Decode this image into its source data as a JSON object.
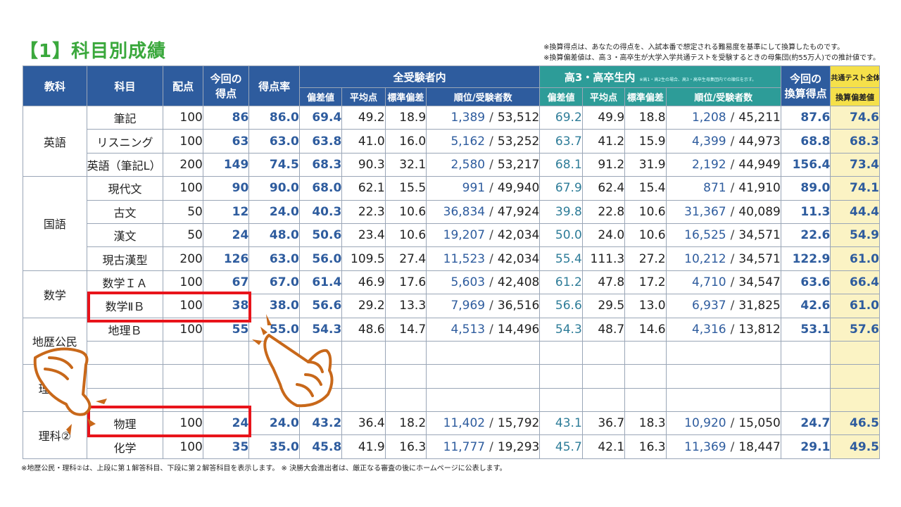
{
  "title": "【1】科目別成績",
  "notes": [
    "※換算得点は、あなたの得点を、入試本番で想定される難易度を基準にして換算したものです。",
    "※換算偏差値は、高３・高卒生が大学入学共通テストを受験するときの母集団(約55万人)での推計値です。"
  ],
  "headers": {
    "kyouka": "教科",
    "kamoku": "科目",
    "haiten": "配点",
    "konkai_line1": "今回の",
    "konkai_line2": "得点",
    "tokutenritsu": "得点率",
    "all_group": "全受験者内",
    "hs_group": "高3・高卒生内",
    "hs_note": "※高1・高2生の場合、高3・高卒生母集団内での順位を示す。",
    "hensachi": "偏差値",
    "heikin": "平均点",
    "hyoujun": "標準偏差",
    "juni": "順位/受験者数",
    "kansan_line1": "今回の",
    "kansan_line2": "換算得点",
    "common_test": "共通テスト全体",
    "kansan_hensachi": "換算偏差値"
  },
  "groups": {
    "english": "英語",
    "japanese": "国語",
    "math": "数学",
    "social": "地歴公民",
    "science1": "理科①",
    "science2": "理科②"
  },
  "rows": [
    {
      "subject": "筆記",
      "haiten": "100",
      "score": "86",
      "rate": "86.0",
      "dev": "69.4",
      "avg": "49.2",
      "sd": "18.9",
      "rank": "1,389",
      "total": "53,512",
      "hs_dev": "69.2",
      "hs_avg": "49.9",
      "hs_sd": "18.8",
      "hs_rank": "1,208",
      "hs_total": "45,211",
      "conv": "87.6",
      "conv_dev": "74.6"
    },
    {
      "subject": "リスニング",
      "haiten": "100",
      "score": "63",
      "rate": "63.0",
      "dev": "63.8",
      "avg": "41.0",
      "sd": "16.0",
      "rank": "5,162",
      "total": "53,252",
      "hs_dev": "63.7",
      "hs_avg": "41.2",
      "hs_sd": "15.9",
      "hs_rank": "4,399",
      "hs_total": "44,973",
      "conv": "68.8",
      "conv_dev": "68.3"
    },
    {
      "subject": "英語（筆記L）",
      "haiten": "200",
      "score": "149",
      "rate": "74.5",
      "dev": "68.3",
      "avg": "90.3",
      "sd": "32.1",
      "rank": "2,580",
      "total": "53,217",
      "hs_dev": "68.1",
      "hs_avg": "91.2",
      "hs_sd": "31.9",
      "hs_rank": "2,192",
      "hs_total": "44,949",
      "conv": "156.4",
      "conv_dev": "73.4"
    },
    {
      "subject": "現代文",
      "haiten": "100",
      "score": "90",
      "rate": "90.0",
      "dev": "68.0",
      "avg": "62.1",
      "sd": "15.5",
      "rank": "991",
      "total": "49,940",
      "hs_dev": "67.9",
      "hs_avg": "62.4",
      "hs_sd": "15.4",
      "hs_rank": "871",
      "hs_total": "41,910",
      "conv": "89.0",
      "conv_dev": "74.1"
    },
    {
      "subject": "古文",
      "haiten": "50",
      "score": "12",
      "rate": "24.0",
      "dev": "40.3",
      "avg": "22.3",
      "sd": "10.6",
      "rank": "36,834",
      "total": "47,924",
      "hs_dev": "39.8",
      "hs_avg": "22.8",
      "hs_sd": "10.6",
      "hs_rank": "31,367",
      "hs_total": "40,089",
      "conv": "11.3",
      "conv_dev": "44.4"
    },
    {
      "subject": "漢文",
      "haiten": "50",
      "score": "24",
      "rate": "48.0",
      "dev": "50.6",
      "avg": "23.4",
      "sd": "10.6",
      "rank": "19,207",
      "total": "42,034",
      "hs_dev": "50.0",
      "hs_avg": "24.0",
      "hs_sd": "10.6",
      "hs_rank": "16,525",
      "hs_total": "34,571",
      "conv": "22.6",
      "conv_dev": "54.9"
    },
    {
      "subject": "現古漢型",
      "haiten": "200",
      "score": "126",
      "rate": "63.0",
      "dev": "56.0",
      "avg": "109.5",
      "sd": "27.4",
      "rank": "11,523",
      "total": "42,034",
      "hs_dev": "55.4",
      "hs_avg": "111.3",
      "hs_sd": "27.2",
      "hs_rank": "10,212",
      "hs_total": "34,571",
      "conv": "122.9",
      "conv_dev": "61.0"
    },
    {
      "subject": "数学ＩＡ",
      "haiten": "100",
      "score": "67",
      "rate": "67.0",
      "dev": "61.4",
      "avg": "46.9",
      "sd": "17.6",
      "rank": "5,603",
      "total": "42,408",
      "hs_dev": "61.2",
      "hs_avg": "47.8",
      "hs_sd": "17.2",
      "hs_rank": "4,710",
      "hs_total": "34,547",
      "conv": "63.6",
      "conv_dev": "66.4"
    },
    {
      "subject": "数学ⅡＢ",
      "haiten": "100",
      "score": "38",
      "rate": "38.0",
      "dev": "56.6",
      "avg": "29.2",
      "sd": "13.3",
      "rank": "7,969",
      "total": "36,516",
      "hs_dev": "56.6",
      "hs_avg": "29.5",
      "hs_sd": "13.0",
      "hs_rank": "6,937",
      "hs_total": "31,825",
      "conv": "42.6",
      "conv_dev": "61.0"
    },
    {
      "subject": "地理Ｂ",
      "haiten": "100",
      "score": "55",
      "rate": "55.0",
      "dev": "54.3",
      "avg": "48.6",
      "sd": "14.7",
      "rank": "4,513",
      "total": "14,496",
      "hs_dev": "54.3",
      "hs_avg": "48.7",
      "hs_sd": "14.6",
      "hs_rank": "4,316",
      "hs_total": "13,812",
      "conv": "53.1",
      "conv_dev": "57.6"
    },
    {
      "subject": "物理",
      "haiten": "100",
      "score": "24",
      "rate": "24.0",
      "dev": "43.2",
      "avg": "36.4",
      "sd": "18.2",
      "rank": "11,402",
      "total": "15,792",
      "hs_dev": "43.1",
      "hs_avg": "36.7",
      "hs_sd": "18.3",
      "hs_rank": "10,920",
      "hs_total": "15,050",
      "conv": "24.7",
      "conv_dev": "46.5"
    },
    {
      "subject": "化学",
      "haiten": "100",
      "score": "35",
      "rate": "35.0",
      "dev": "45.8",
      "avg": "41.9",
      "sd": "16.3",
      "rank": "11,777",
      "total": "19,293",
      "hs_dev": "45.7",
      "hs_avg": "42.1",
      "hs_sd": "16.3",
      "hs_rank": "11,369",
      "hs_total": "18,447",
      "conv": "29.1",
      "conv_dev": "49.5"
    }
  ],
  "rank_separator": "/",
  "footer": "※地歴公民・理科②は、上段に第１解答科目、下段に第２解答科目を表示します。 ※ 決勝大会進出者は、厳正なる審査の後にホームページに公表します。",
  "colors": {
    "accent_red": "#e8141b",
    "header_blue": "#2e5c9e",
    "header_teal": "#2d9c98",
    "conv_yellow": "#f5e04a",
    "hand_brown": "#c8681a"
  }
}
